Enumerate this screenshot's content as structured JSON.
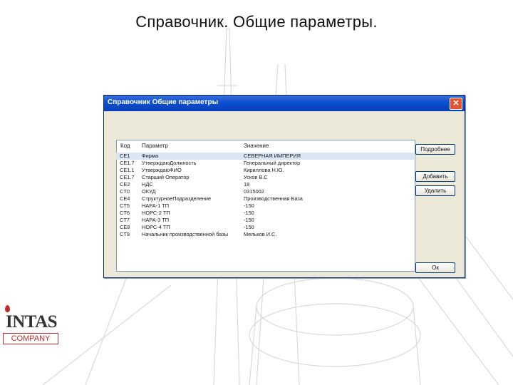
{
  "slide": {
    "title": "Справочник. Общие параметры."
  },
  "dialog": {
    "title": "Справочник Общие параметры",
    "close_label": "✕",
    "columns": {
      "code": "Код",
      "param": "Параметр",
      "value": "Значение"
    },
    "rows": [
      {
        "code": "CE1",
        "param": "Фирма",
        "value": "СЕВЕРНАЯ ИМПЕРИЯ"
      },
      {
        "code": "CE1.7",
        "param": "УтверждаюДолжность",
        "value": "Генеральный директор"
      },
      {
        "code": "CE1.1",
        "param": "УтверждаюФИО",
        "value": "Кириллова Н.Ю."
      },
      {
        "code": "CE1.7",
        "param": "Старший Оператор",
        "value": "Усков В.С"
      },
      {
        "code": "CE2",
        "param": "НДС",
        "value": "18"
      },
      {
        "code": "CT0",
        "param": "ОКУД",
        "value": "0315002"
      },
      {
        "code": "CE4",
        "param": "СтруктурноеПодразделение",
        "value": "Производственная База"
      },
      {
        "code": "CT5",
        "param": "НАРА-1 ТП",
        "value": "-150"
      },
      {
        "code": "CT6",
        "param": "НОРС-2 ТП",
        "value": "-150"
      },
      {
        "code": "CT7",
        "param": "НАРА-3 ТП",
        "value": "-150"
      },
      {
        "code": "CE8",
        "param": "НОРС-4 ТП",
        "value": "-150"
      },
      {
        "code": "CT9",
        "param": "Начальник производственной базы",
        "value": "Мельков И.С."
      }
    ],
    "buttons": {
      "details": "Подробнее",
      "add": "Добавить",
      "delete": "Удалить",
      "ok": "Ок"
    }
  },
  "logo": {
    "main": "INTAS",
    "sub": "COMPANY"
  },
  "colors": {
    "titlebar": "#0a4fd0",
    "close": "#e2532f",
    "brand_red": "#c12b2b"
  }
}
